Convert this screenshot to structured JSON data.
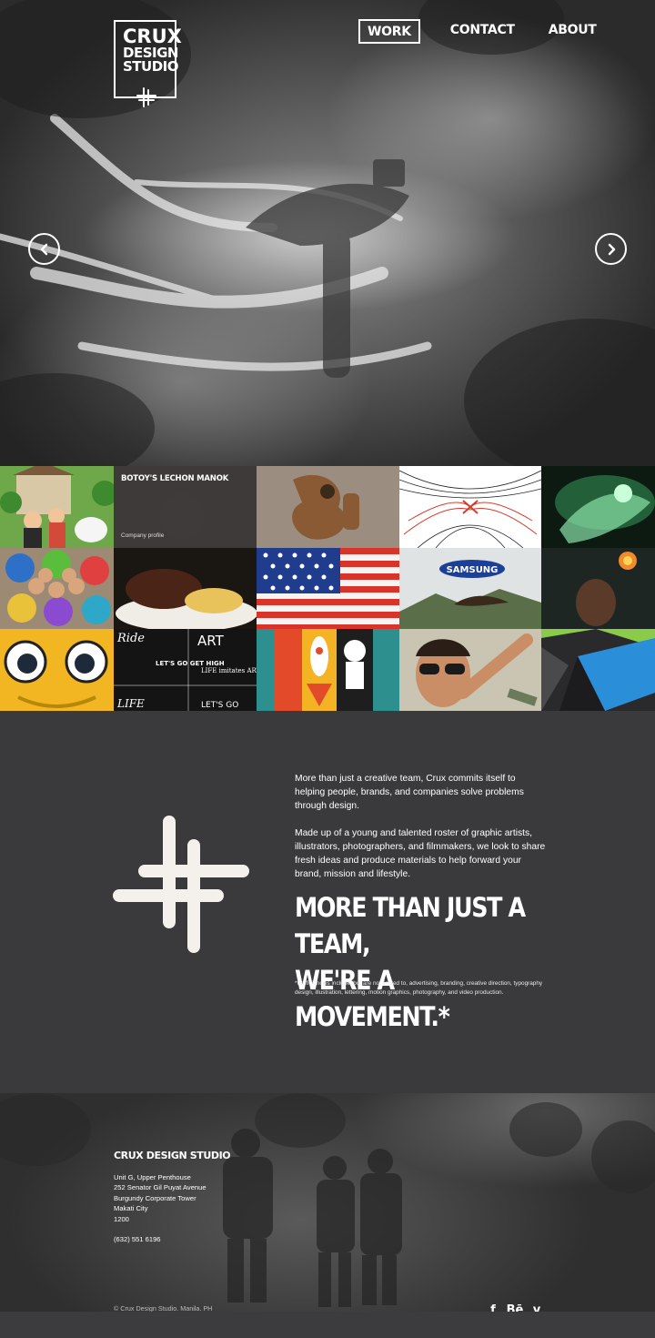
{
  "brand": {
    "logo_lines": [
      "CRUX",
      "DESIGN",
      "STUDIO"
    ]
  },
  "nav": {
    "items": [
      {
        "label": "WORK",
        "active": true
      },
      {
        "label": "CONTACT",
        "active": false
      },
      {
        "label": "ABOUT",
        "active": false
      }
    ]
  },
  "hero": {
    "prev_icon": "chevron-left-icon",
    "next_icon": "chevron-right-icon"
  },
  "portfolio": {
    "featured": {
      "title": "BOTOY'S LECHON MANOK",
      "subtitle": "Company profile"
    },
    "tile_texts": {
      "samsung": "SAMSUNG",
      "art_poster": [
        "Ride",
        "ART",
        "LET'S GO GET HIGH",
        "LIFE imitates ART",
        "LIFE",
        "LET'S GO"
      ]
    }
  },
  "about": {
    "paragraph_1": "More than just a creative team, Crux commits itself to helping people, brands, and companies solve problems through design.",
    "paragraph_2": "Made up of a young and talented roster of graphic artists, illustrators, photographers, and filmmakers, we look to share fresh ideas and produce materials to help forward your brand, mission and lifestyle.",
    "headline_line_1": "MORE THAN JUST A TEAM,",
    "headline_line_2": "WE'RE A MOVEMENT.*",
    "footnote": "*Proficiencies include, but are not limited to, advertising, branding, creative direction, typography design, illustration, lettering, motion graphics, photography, and video production."
  },
  "footer": {
    "company": "CRUX DESIGN STUDIO",
    "address_lines": [
      "Unit G, Upper Penthouse",
      "252 Senator Gil Puyat Avenue",
      "Burgundy Corporate Tower",
      "Makati City",
      "1200"
    ],
    "phone": "(632) 551 6196",
    "copyright": "© Crux Design Studio. Manila. PH",
    "social": [
      {
        "label": "f",
        "icon": "facebook-icon"
      },
      {
        "label": "Bē",
        "icon": "behance-icon"
      },
      {
        "label": "v",
        "icon": "vimeo-icon"
      }
    ]
  },
  "colors": {
    "background": "#3a3a3c",
    "text": "#ffffff"
  }
}
